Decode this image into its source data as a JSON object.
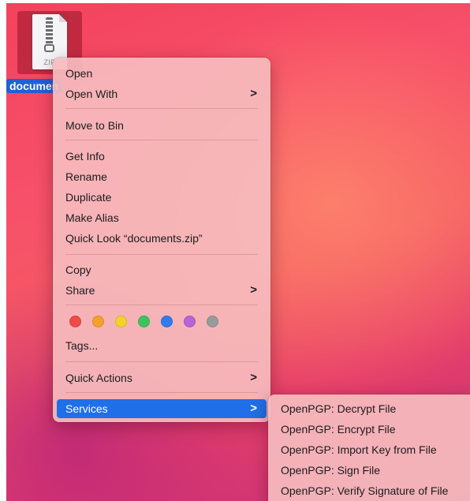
{
  "desktop": {
    "file": {
      "extension_label": "ZIP",
      "name_label": "documen"
    }
  },
  "context_menu": {
    "open": "Open",
    "open_with": "Open With",
    "move_to_bin": "Move to Bin",
    "get_info": "Get Info",
    "rename": "Rename",
    "duplicate": "Duplicate",
    "make_alias": "Make Alias",
    "quick_look": "Quick Look “documents.zip”",
    "copy": "Copy",
    "share": "Share",
    "tags": "Tags...",
    "quick_actions": "Quick Actions",
    "services": "Services",
    "submenu_chevron": ">",
    "tag_colors": [
      "#f04b4b",
      "#f5a02a",
      "#f5d22b",
      "#3cc45a",
      "#2f7cf0",
      "#b565d8",
      "#9a9a9c"
    ]
  },
  "services_submenu": {
    "items": [
      "OpenPGP: Decrypt File",
      "OpenPGP: Encrypt File",
      "OpenPGP: Import Key from File",
      "OpenPGP: Sign File",
      "OpenPGP: Verify Signature of File"
    ]
  },
  "colors": {
    "selection_blue": "#1f6fe8",
    "menu_background": "#f6bcbe"
  }
}
